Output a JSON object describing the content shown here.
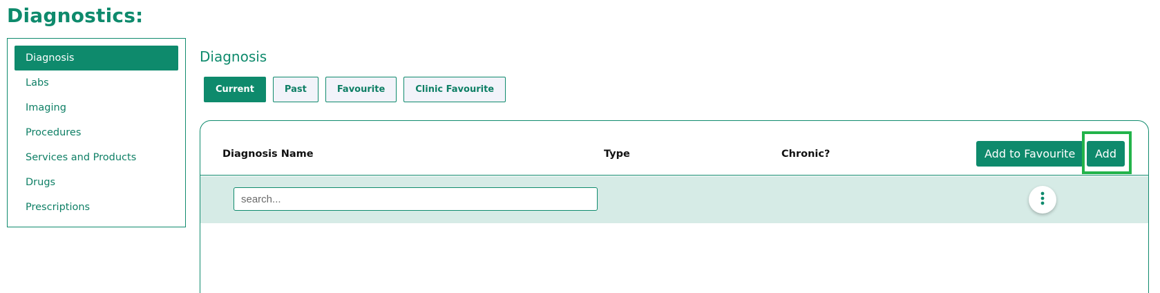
{
  "page": {
    "title": "Diagnostics:"
  },
  "sidebar": {
    "items": [
      {
        "label": "Diagnosis",
        "active": true
      },
      {
        "label": "Labs"
      },
      {
        "label": "Imaging"
      },
      {
        "label": "Procedures"
      },
      {
        "label": "Services and Products"
      },
      {
        "label": "Drugs"
      },
      {
        "label": "Prescriptions"
      }
    ]
  },
  "main": {
    "section_title": "Diagnosis",
    "tabs": [
      {
        "label": "Current",
        "active": true
      },
      {
        "label": "Past"
      },
      {
        "label": "Favourite"
      },
      {
        "label": "Clinic Favourite"
      }
    ],
    "table": {
      "columns": [
        "Diagnosis Name",
        "Type",
        "Chronic?"
      ],
      "add_to_favourite_label": "Add to Favourite",
      "add_label": "Add",
      "search_placeholder": "search..."
    }
  },
  "icons": {
    "row_menu": "more-vertical-icon"
  },
  "colors": {
    "brand": "#0e8a6c",
    "highlight": "#22b34a",
    "filter_row_bg": "#d6ebe6"
  }
}
